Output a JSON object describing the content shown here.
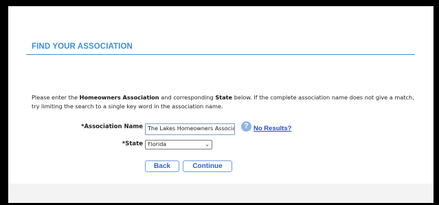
{
  "header": {
    "title": "FIND YOUR ASSOCIATION"
  },
  "instructions": {
    "part1": "Please enter the ",
    "bold1": "Homeowners Association",
    "part2": " and corresponding ",
    "bold2": "State",
    "part3": " below. If the complete association name does not give a match, try limiting the search to a single key word in the association name."
  },
  "form": {
    "association_label": "*Association Name",
    "association_value": "The Lakes Homeowners Associa",
    "state_label": "*State",
    "state_value": "Florida",
    "help_icon": "?",
    "no_results_link": "No Results?"
  },
  "buttons": {
    "back": "Back",
    "continue": "Continue"
  },
  "colors": {
    "accent": "#3d8fd8",
    "link": "#1f4fbf",
    "button_text": "#2a66c6"
  }
}
